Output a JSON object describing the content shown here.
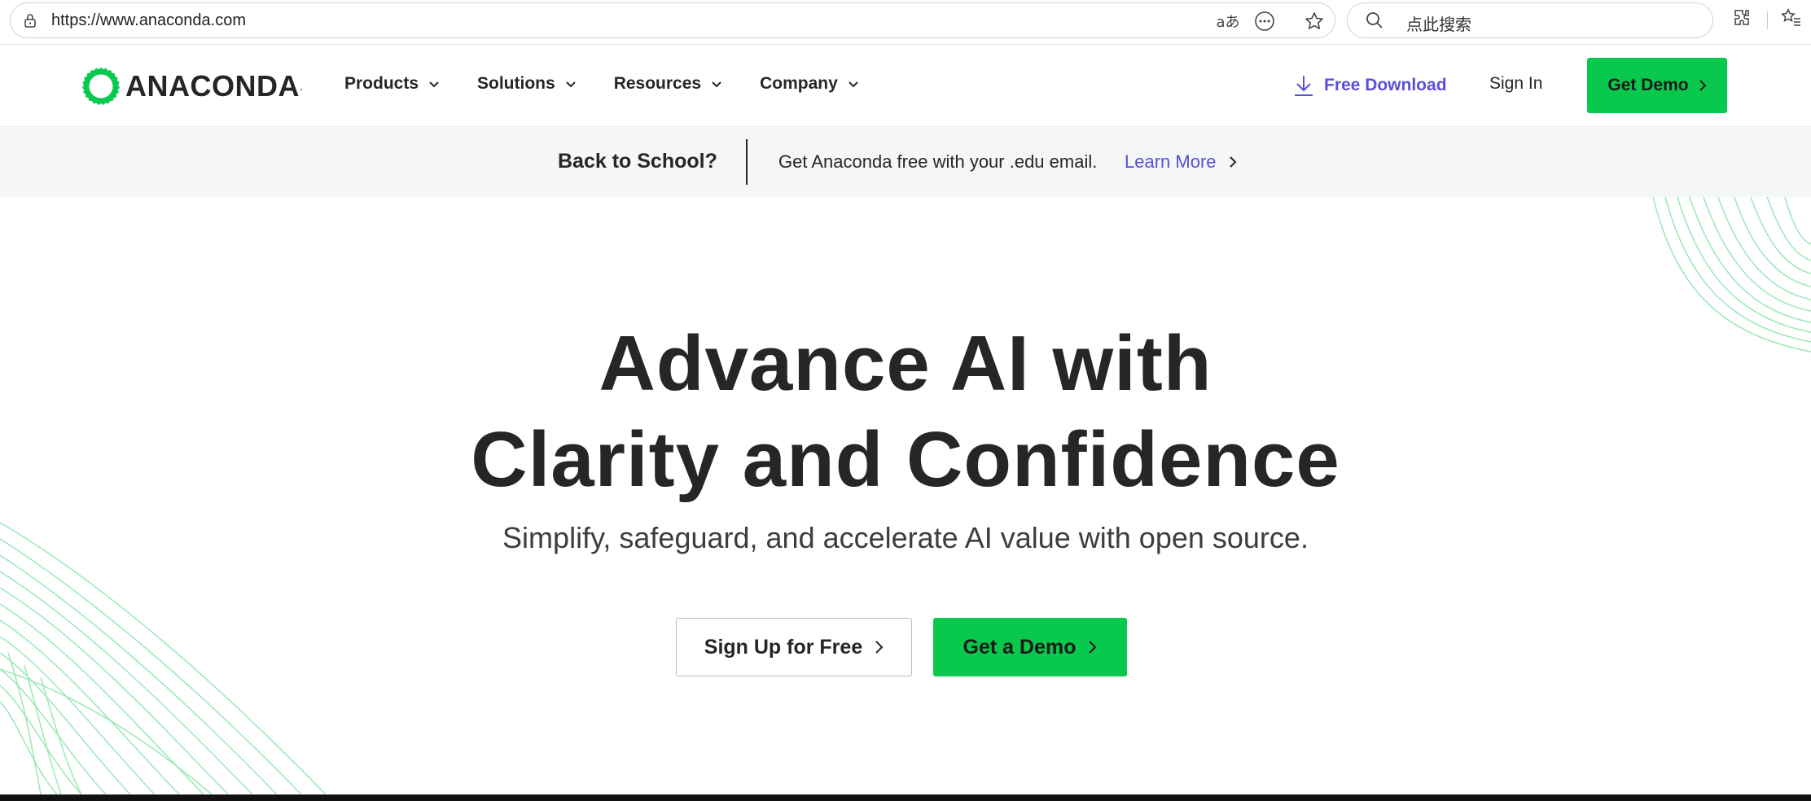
{
  "browser": {
    "url": "https://www.anaconda.com",
    "search_placeholder": "点此搜索",
    "translate_icon_text": "aあ"
  },
  "header": {
    "logo_text": "ANACONDA",
    "logo_dot": ".",
    "nav": [
      {
        "label": "Products"
      },
      {
        "label": "Solutions"
      },
      {
        "label": "Resources"
      },
      {
        "label": "Company"
      }
    ],
    "free_download": "Free Download",
    "sign_in": "Sign In",
    "get_demo": "Get Demo"
  },
  "promo": {
    "title": "Back to School?",
    "text": "Get Anaconda free with your .edu email.",
    "link": "Learn More"
  },
  "hero": {
    "title_line1": "Advance AI with",
    "title_line2": "Clarity and Confidence",
    "subtitle": "Simplify, safeguard, and accelerate AI value with open source.",
    "signup_button": "Sign Up for Free",
    "demo_button": "Get a Demo"
  },
  "colors": {
    "brand_green": "#08c94d",
    "link_purple": "#5b4fd6",
    "text_dark": "#262626"
  }
}
